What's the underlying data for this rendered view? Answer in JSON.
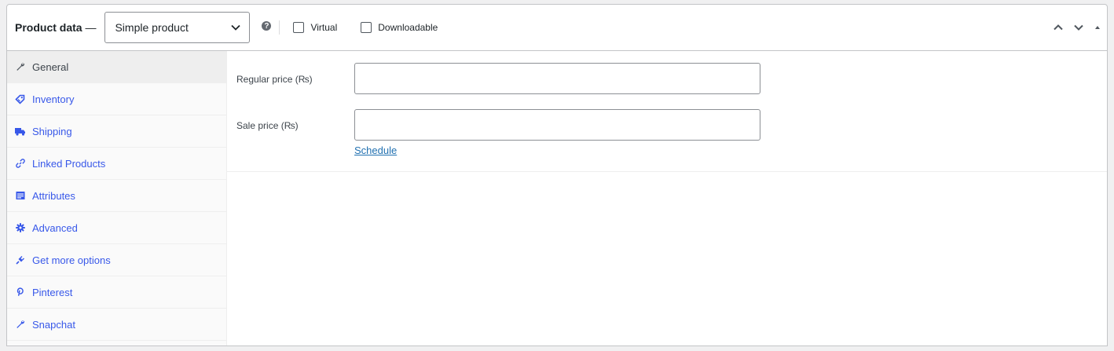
{
  "header": {
    "title": "Product data",
    "dash": "—",
    "product_type": "Simple product",
    "help_glyph": "?",
    "virtual_label": "Virtual",
    "virtual_checked": false,
    "downloadable_label": "Downloadable",
    "downloadable_checked": false
  },
  "tabs": [
    {
      "label": "General",
      "icon": "wrench-icon",
      "active": true
    },
    {
      "label": "Inventory",
      "icon": "tag-icon",
      "active": false
    },
    {
      "label": "Shipping",
      "icon": "truck-icon",
      "active": false
    },
    {
      "label": "Linked Products",
      "icon": "link-icon",
      "active": false
    },
    {
      "label": "Attributes",
      "icon": "list-table-icon",
      "active": false
    },
    {
      "label": "Advanced",
      "icon": "gear-icon",
      "active": false
    },
    {
      "label": "Get more options",
      "icon": "plugin-icon",
      "active": false
    },
    {
      "label": "Pinterest",
      "icon": "pinterest-icon",
      "active": false
    },
    {
      "label": "Snapchat",
      "icon": "wrench-icon",
      "active": false
    }
  ],
  "general": {
    "regular_price_label": "Regular price (₨)",
    "regular_price_value": "",
    "sale_price_label": "Sale price (₨)",
    "sale_price_value": "",
    "schedule_link": "Schedule"
  },
  "colors": {
    "accent": "#2271b1",
    "tab_label": "#3858e9",
    "border": "#c3c4c7"
  }
}
